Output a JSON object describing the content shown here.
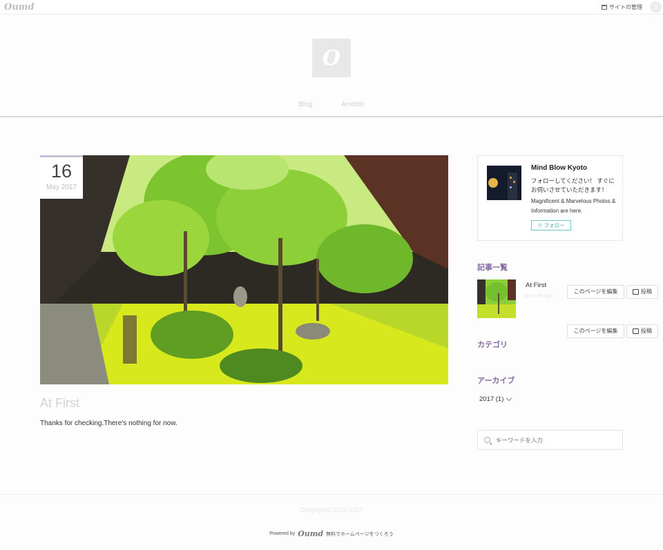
{
  "topbar": {
    "brand": "Oumd",
    "manage_label": "サイトの管理",
    "avatar_letter": "0"
  },
  "header": {
    "logo_letter": "O",
    "nav": [
      {
        "label": "Blog"
      },
      {
        "label": "Ameblo"
      }
    ]
  },
  "post": {
    "day": "16",
    "month_year": "May 2017",
    "title": "At First",
    "body": "Thanks for checking.There's nothing for now."
  },
  "sidebar": {
    "profile": {
      "name": "Mind Blow Kyoto",
      "message": "フォローしてください！ すぐにお伺いさせていただきます！",
      "description": "Magnificent & Marvelous Photos & Information are here.",
      "follow_label": "フォロー"
    },
    "entries_heading": "記事一覧",
    "entries": [
      {
        "title": "At First",
        "date": "a month ago"
      }
    ],
    "edit_page_label": "このページを編集",
    "post_label": "投稿",
    "category_heading": "カテゴリ",
    "archive_heading": "アーカイブ",
    "archive_item": "2017 (1)",
    "search_placeholder": "キーワードを入力"
  },
  "footer": {
    "copyright": "Copyright© 2016-2017",
    "powered_prefix": "Powered by",
    "powered_brand": "Oumd",
    "powered_suffix": "無料でホームページをつくろう"
  },
  "colors": {
    "accent_purple": "#866aa3",
    "follow_teal": "#47a79f",
    "nav_line": "#d9d5e3"
  }
}
